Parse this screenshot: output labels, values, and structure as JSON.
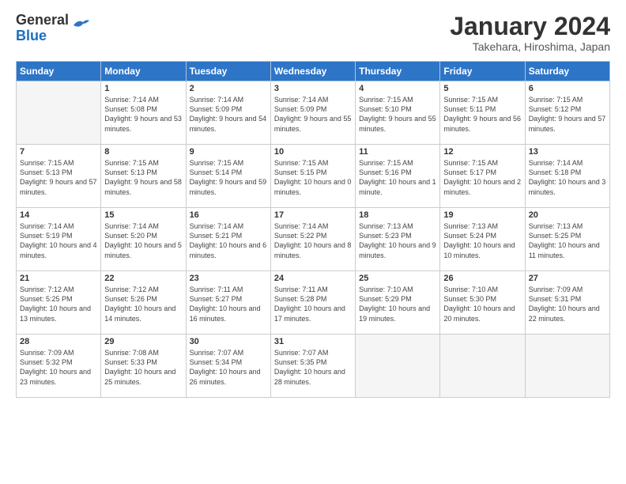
{
  "header": {
    "logo_general": "General",
    "logo_blue": "Blue",
    "title": "January 2024",
    "location": "Takehara, Hiroshima, Japan"
  },
  "weekdays": [
    "Sunday",
    "Monday",
    "Tuesday",
    "Wednesday",
    "Thursday",
    "Friday",
    "Saturday"
  ],
  "weeks": [
    [
      {
        "day": "",
        "sunrise": "",
        "sunset": "",
        "daylight": ""
      },
      {
        "day": "1",
        "sunrise": "Sunrise: 7:14 AM",
        "sunset": "Sunset: 5:08 PM",
        "daylight": "Daylight: 9 hours and 53 minutes."
      },
      {
        "day": "2",
        "sunrise": "Sunrise: 7:14 AM",
        "sunset": "Sunset: 5:09 PM",
        "daylight": "Daylight: 9 hours and 54 minutes."
      },
      {
        "day": "3",
        "sunrise": "Sunrise: 7:14 AM",
        "sunset": "Sunset: 5:09 PM",
        "daylight": "Daylight: 9 hours and 55 minutes."
      },
      {
        "day": "4",
        "sunrise": "Sunrise: 7:15 AM",
        "sunset": "Sunset: 5:10 PM",
        "daylight": "Daylight: 9 hours and 55 minutes."
      },
      {
        "day": "5",
        "sunrise": "Sunrise: 7:15 AM",
        "sunset": "Sunset: 5:11 PM",
        "daylight": "Daylight: 9 hours and 56 minutes."
      },
      {
        "day": "6",
        "sunrise": "Sunrise: 7:15 AM",
        "sunset": "Sunset: 5:12 PM",
        "daylight": "Daylight: 9 hours and 57 minutes."
      }
    ],
    [
      {
        "day": "7",
        "sunrise": "Sunrise: 7:15 AM",
        "sunset": "Sunset: 5:13 PM",
        "daylight": "Daylight: 9 hours and 57 minutes."
      },
      {
        "day": "8",
        "sunrise": "Sunrise: 7:15 AM",
        "sunset": "Sunset: 5:13 PM",
        "daylight": "Daylight: 9 hours and 58 minutes."
      },
      {
        "day": "9",
        "sunrise": "Sunrise: 7:15 AM",
        "sunset": "Sunset: 5:14 PM",
        "daylight": "Daylight: 9 hours and 59 minutes."
      },
      {
        "day": "10",
        "sunrise": "Sunrise: 7:15 AM",
        "sunset": "Sunset: 5:15 PM",
        "daylight": "Daylight: 10 hours and 0 minutes."
      },
      {
        "day": "11",
        "sunrise": "Sunrise: 7:15 AM",
        "sunset": "Sunset: 5:16 PM",
        "daylight": "Daylight: 10 hours and 1 minute."
      },
      {
        "day": "12",
        "sunrise": "Sunrise: 7:15 AM",
        "sunset": "Sunset: 5:17 PM",
        "daylight": "Daylight: 10 hours and 2 minutes."
      },
      {
        "day": "13",
        "sunrise": "Sunrise: 7:14 AM",
        "sunset": "Sunset: 5:18 PM",
        "daylight": "Daylight: 10 hours and 3 minutes."
      }
    ],
    [
      {
        "day": "14",
        "sunrise": "Sunrise: 7:14 AM",
        "sunset": "Sunset: 5:19 PM",
        "daylight": "Daylight: 10 hours and 4 minutes."
      },
      {
        "day": "15",
        "sunrise": "Sunrise: 7:14 AM",
        "sunset": "Sunset: 5:20 PM",
        "daylight": "Daylight: 10 hours and 5 minutes."
      },
      {
        "day": "16",
        "sunrise": "Sunrise: 7:14 AM",
        "sunset": "Sunset: 5:21 PM",
        "daylight": "Daylight: 10 hours and 6 minutes."
      },
      {
        "day": "17",
        "sunrise": "Sunrise: 7:14 AM",
        "sunset": "Sunset: 5:22 PM",
        "daylight": "Daylight: 10 hours and 8 minutes."
      },
      {
        "day": "18",
        "sunrise": "Sunrise: 7:13 AM",
        "sunset": "Sunset: 5:23 PM",
        "daylight": "Daylight: 10 hours and 9 minutes."
      },
      {
        "day": "19",
        "sunrise": "Sunrise: 7:13 AM",
        "sunset": "Sunset: 5:24 PM",
        "daylight": "Daylight: 10 hours and 10 minutes."
      },
      {
        "day": "20",
        "sunrise": "Sunrise: 7:13 AM",
        "sunset": "Sunset: 5:25 PM",
        "daylight": "Daylight: 10 hours and 11 minutes."
      }
    ],
    [
      {
        "day": "21",
        "sunrise": "Sunrise: 7:12 AM",
        "sunset": "Sunset: 5:25 PM",
        "daylight": "Daylight: 10 hours and 13 minutes."
      },
      {
        "day": "22",
        "sunrise": "Sunrise: 7:12 AM",
        "sunset": "Sunset: 5:26 PM",
        "daylight": "Daylight: 10 hours and 14 minutes."
      },
      {
        "day": "23",
        "sunrise": "Sunrise: 7:11 AM",
        "sunset": "Sunset: 5:27 PM",
        "daylight": "Daylight: 10 hours and 16 minutes."
      },
      {
        "day": "24",
        "sunrise": "Sunrise: 7:11 AM",
        "sunset": "Sunset: 5:28 PM",
        "daylight": "Daylight: 10 hours and 17 minutes."
      },
      {
        "day": "25",
        "sunrise": "Sunrise: 7:10 AM",
        "sunset": "Sunset: 5:29 PM",
        "daylight": "Daylight: 10 hours and 19 minutes."
      },
      {
        "day": "26",
        "sunrise": "Sunrise: 7:10 AM",
        "sunset": "Sunset: 5:30 PM",
        "daylight": "Daylight: 10 hours and 20 minutes."
      },
      {
        "day": "27",
        "sunrise": "Sunrise: 7:09 AM",
        "sunset": "Sunset: 5:31 PM",
        "daylight": "Daylight: 10 hours and 22 minutes."
      }
    ],
    [
      {
        "day": "28",
        "sunrise": "Sunrise: 7:09 AM",
        "sunset": "Sunset: 5:32 PM",
        "daylight": "Daylight: 10 hours and 23 minutes."
      },
      {
        "day": "29",
        "sunrise": "Sunrise: 7:08 AM",
        "sunset": "Sunset: 5:33 PM",
        "daylight": "Daylight: 10 hours and 25 minutes."
      },
      {
        "day": "30",
        "sunrise": "Sunrise: 7:07 AM",
        "sunset": "Sunset: 5:34 PM",
        "daylight": "Daylight: 10 hours and 26 minutes."
      },
      {
        "day": "31",
        "sunrise": "Sunrise: 7:07 AM",
        "sunset": "Sunset: 5:35 PM",
        "daylight": "Daylight: 10 hours and 28 minutes."
      },
      {
        "day": "",
        "sunrise": "",
        "sunset": "",
        "daylight": ""
      },
      {
        "day": "",
        "sunrise": "",
        "sunset": "",
        "daylight": ""
      },
      {
        "day": "",
        "sunrise": "",
        "sunset": "",
        "daylight": ""
      }
    ]
  ]
}
